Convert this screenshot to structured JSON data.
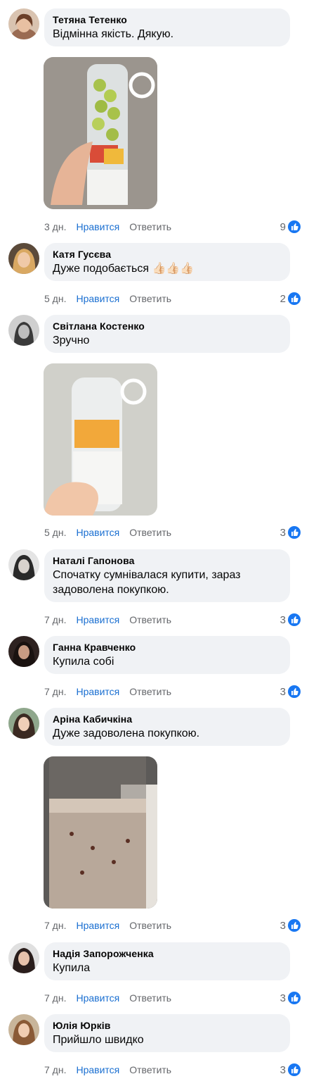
{
  "comments": [
    {
      "author": "Тетяна Тетенко",
      "text": "Відмінна якість. Дякую.",
      "time": "3 дн.",
      "like_label": "Нравится",
      "reply_label": "Ответить",
      "reactions": "9",
      "avatar_color": "#b68466",
      "has_photo": true
    },
    {
      "author": "Катя Гусєва",
      "text": "Дуже подобається 👍🏻👍🏻👍🏻",
      "time": "5 дн.",
      "like_label": "Нравится",
      "reply_label": "Ответить",
      "reactions": "2",
      "avatar_color": "#c99a6b"
    },
    {
      "author": "Світлана Костенко",
      "text": "Зручно",
      "time": "5 дн.",
      "like_label": "Нравится",
      "reply_label": "Ответить",
      "reactions": "3",
      "avatar_color": "#6f6f6f",
      "has_photo": true
    },
    {
      "author": "Наталі Гапонова",
      "text": "Спочатку сумнівалася купити, зараз задоволена покупкою.",
      "time": "7 дн.",
      "like_label": "Нравится",
      "reply_label": "Ответить",
      "reactions": "3",
      "avatar_color": "#3a3a3a"
    },
    {
      "author": "Ганна Кравченко",
      "text": "Купила собі",
      "time": "7 дн.",
      "like_label": "Нравится",
      "reply_label": "Ответить",
      "reactions": "3",
      "avatar_color": "#5a3b35"
    },
    {
      "author": "Аріна Кабичкіна",
      "text": "Дуже задоволена покупкою.",
      "time": "7 дн.",
      "like_label": "Нравится",
      "reply_label": "Ответить",
      "reactions": "3",
      "avatar_color": "#6b8a6a",
      "has_photo": true
    },
    {
      "author": "Надія Запорожченка",
      "text": "Купила",
      "time": "7 дн.",
      "like_label": "Нравится",
      "reply_label": "Ответить",
      "reactions": "3",
      "avatar_color": "#4a3a38"
    },
    {
      "author": "Юлія Юрків",
      "text": "Прийшло швидко",
      "time": "7 дн.",
      "like_label": "Нравится",
      "reply_label": "Ответить",
      "reactions": "3",
      "avatar_color": "#a77a55"
    }
  ],
  "colors": {
    "bubble": "#f0f2f5",
    "like": "#1a6fd1",
    "meta": "#65676b",
    "like_badge": "#1877f2"
  }
}
